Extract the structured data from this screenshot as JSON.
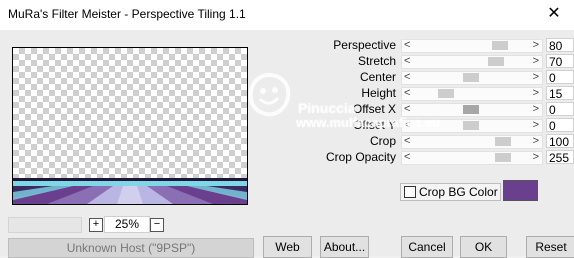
{
  "window": {
    "title": "MuRa's Filter Meister - Perspective Tiling 1.1",
    "close_glyph": "✕"
  },
  "preview": {
    "zoom_percent": "25%",
    "zoom_in_label": "+",
    "zoom_out_label": "−"
  },
  "host_status": "Unknown Host (\"9PSP\")",
  "sliders": [
    {
      "label": "Perspective",
      "value": "80",
      "fraction": 0.8
    },
    {
      "label": "Stretch",
      "value": "70",
      "fraction": 0.76
    },
    {
      "label": "Center",
      "value": "0",
      "fraction": 0.5
    },
    {
      "label": "Height",
      "value": "15",
      "fraction": 0.24
    },
    {
      "label": "Offset X",
      "value": "0",
      "fraction": 0.5
    },
    {
      "label": "Offset Y",
      "value": "0",
      "fraction": 0.5
    },
    {
      "label": "Crop",
      "value": "100",
      "fraction": 0.83
    },
    {
      "label": "Crop Opacity",
      "value": "255",
      "fraction": 0.83
    }
  ],
  "crop_bg": {
    "label": "Crop BG Color",
    "checked": false,
    "color": "#6a3f8e"
  },
  "buttons": {
    "web": "Web",
    "about": "About...",
    "cancel": "Cancel",
    "ok": "OK",
    "reset": "Reset"
  },
  "watermark": {
    "name": "Pinuccia",
    "site": "www.mulfacaprafica.eu"
  },
  "colors": {
    "titlebar_bg": "#ffffff",
    "dialog_bg": "#ececec",
    "tile_purple": "#6a3f8e",
    "tile_cyan": "#7fd6e6"
  }
}
